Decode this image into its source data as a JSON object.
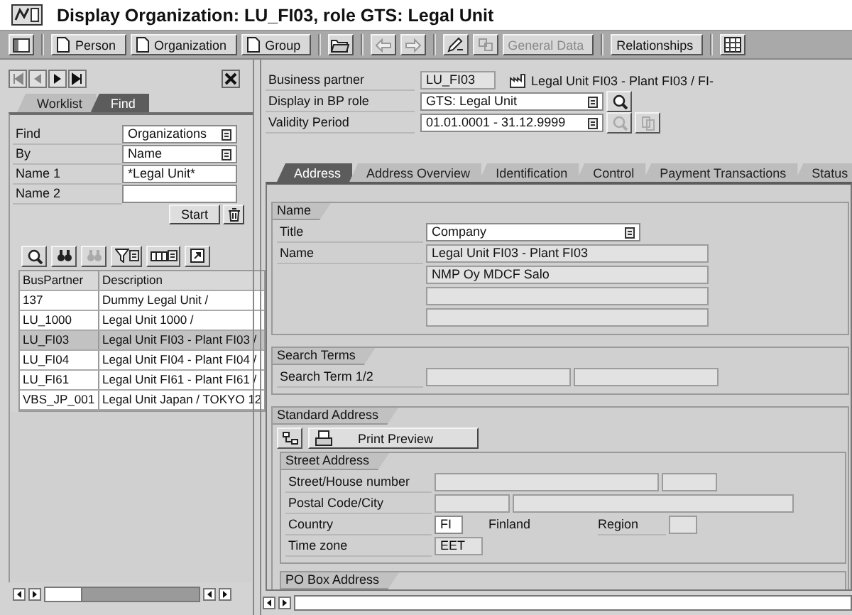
{
  "window": {
    "title": "Display Organization: LU_FI03, role GTS: Legal Unit"
  },
  "toolbar": {
    "buttons": [
      {
        "label": "Person",
        "disabled": false
      },
      {
        "label": "Organization",
        "disabled": false
      },
      {
        "label": "Group",
        "disabled": false
      },
      {
        "label": "General Data",
        "disabled": true
      },
      {
        "label": "Relationships",
        "disabled": false
      }
    ]
  },
  "locator": {
    "tabs": [
      {
        "label": "Worklist",
        "selected": false
      },
      {
        "label": "Find",
        "selected": true
      }
    ],
    "search": {
      "fields": [
        {
          "label": "Find",
          "kind": "dropdown",
          "value": "Organizations"
        },
        {
          "label": "By",
          "kind": "dropdown",
          "value": "Name"
        },
        {
          "label": "Name 1",
          "kind": "input",
          "value": "*Legal Unit*"
        },
        {
          "label": "Name 2",
          "kind": "input"
        }
      ],
      "start_button": "Start"
    },
    "results": {
      "columns": [
        "BusPartner",
        "Description"
      ],
      "rows": [
        {
          "cells": [
            "137",
            "Dummy Legal Unit /"
          ],
          "selected": false
        },
        {
          "cells": [
            "LU_1000",
            "Legal Unit 1000 /"
          ],
          "selected": false
        },
        {
          "cells": [
            "LU_FI03",
            "Legal Unit FI03 - Plant FI03 /"
          ],
          "selected": true
        },
        {
          "cells": [
            "LU_FI04",
            "Legal Unit FI04 - Plant FI04 /"
          ],
          "selected": false
        },
        {
          "cells": [
            "LU_FI61",
            "Legal Unit FI61 - Plant FI61 /"
          ],
          "selected": false
        },
        {
          "cells": [
            "VBS_JP_001",
            "Legal Unit Japan / TOKYO 12"
          ],
          "selected": false
        }
      ]
    }
  },
  "partner_header": {
    "fields": [
      {
        "label": "Business partner",
        "kind": "display",
        "value": "LU_FI03"
      },
      {
        "label": "Display in BP role",
        "kind": "dropdown",
        "value": "GTS: Legal Unit"
      },
      {
        "label": "Validity Period",
        "kind": "dropdown",
        "value": "01.01.0001 - 31.12.9999"
      }
    ],
    "description": "Legal Unit FI03 - Plant FI03 / FI-"
  },
  "detail_tabs": [
    {
      "label": "Address",
      "selected": true
    },
    {
      "label": "Address Overview",
      "selected": false
    },
    {
      "label": "Identification",
      "selected": false
    },
    {
      "label": "Control",
      "selected": false
    },
    {
      "label": "Payment Transactions",
      "selected": false
    },
    {
      "label": "Status",
      "selected": false
    }
  ],
  "sections": [
    {
      "title": "Name",
      "rows": [
        {
          "label": "Title",
          "fields": [
            {
              "kind": "dropdown",
              "value": "Company"
            }
          ]
        },
        {
          "label": "Name",
          "fields": [
            {
              "kind": "display",
              "value": "Legal Unit FI03 - Plant FI03"
            }
          ]
        },
        {
          "fields": [
            {
              "kind": "display",
              "value": "NMP Oy MDCF Salo"
            }
          ]
        },
        {
          "fields": [
            {
              "kind": "display"
            }
          ]
        },
        {
          "fields": [
            {
              "kind": "display"
            }
          ]
        }
      ]
    },
    {
      "title": "Search Terms",
      "rows": [
        {
          "label": "Search Term 1/2",
          "fields": [
            {
              "kind": "display"
            },
            {
              "kind": "display"
            }
          ]
        }
      ]
    },
    {
      "title": "Standard Address",
      "print_button": "Print Preview",
      "subsections": [
        {
          "title": "Street Address",
          "rows": [
            {
              "label": "Street/House number",
              "fields": [
                {
                  "kind": "display"
                },
                {
                  "kind": "display"
                }
              ]
            },
            {
              "label": "Postal Code/City",
              "fields": [
                {
                  "kind": "display"
                },
                {
                  "kind": "display"
                }
              ]
            },
            {
              "label": "Country",
              "fields": [
                {
                  "kind": "input",
                  "value": "FI"
                },
                {
                  "kind": "text",
                  "value": "Finland"
                },
                {
                  "kind": "label",
                  "value": "Region"
                },
                {
                  "kind": "display"
                }
              ]
            },
            {
              "label": "Time zone",
              "fields": [
                {
                  "kind": "display",
                  "value": "EET"
                }
              ]
            }
          ]
        },
        {
          "title": "PO Box Address"
        }
      ]
    }
  ]
}
